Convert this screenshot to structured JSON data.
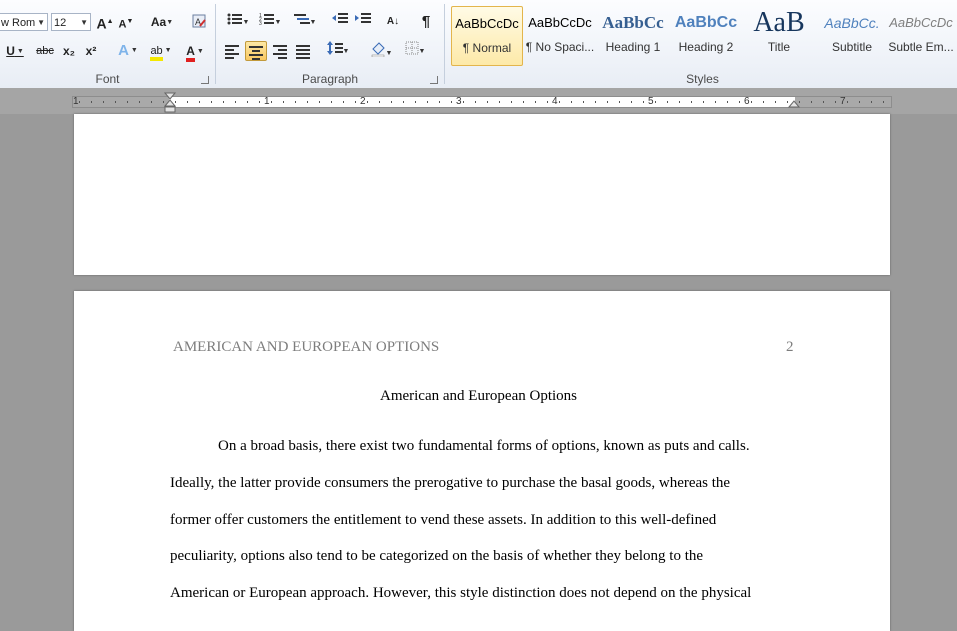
{
  "font_group": {
    "font_name": "w Rom",
    "font_size": "12",
    "label": "Font",
    "grow_label": "A",
    "shrink_label": "A",
    "case_label": "Aa",
    "underline_label": "U",
    "strike_label": "abc",
    "subscript_label": "x₂",
    "superscript_label": "x²",
    "effects_label": "A",
    "highlight_label": "ab",
    "font_color_label": "A"
  },
  "paragraph_group": {
    "label": "Paragraph",
    "pilcrow": "¶",
    "sort_label": "A↓"
  },
  "styles_group": {
    "label": "Styles",
    "styles": [
      {
        "sample": "AaBbCcDc",
        "name": "¶ Normal",
        "selected": true
      },
      {
        "sample": "AaBbCcDc",
        "name": "¶ No Spaci..."
      },
      {
        "sample": "AaBbCc",
        "name": "Heading 1"
      },
      {
        "sample": "AaBbCc",
        "name": "Heading 2"
      },
      {
        "sample": "AaB",
        "name": "Title"
      },
      {
        "sample": "AaBbCc.",
        "name": "Subtitle"
      },
      {
        "sample": "AaBbCcDc",
        "name": "Subtle Em..."
      }
    ]
  },
  "ruler": {
    "numbers": [
      "1",
      "1",
      "2",
      "3",
      "4",
      "5",
      "6",
      "7"
    ]
  },
  "document": {
    "running_head": "AMERICAN AND EUROPEAN OPTIONS",
    "page_number": "2",
    "title": "American and European Options",
    "lines": [
      "On a broad basis, there exist two fundamental forms of options, known as puts and calls.",
      "Ideally, the latter provide consumers the prerogative to purchase the basal goods, whereas the",
      "former offer customers the entitlement to vend these assets. In addition to this well-defined",
      "peculiarity, options also tend to be categorized on the basis of whether they belong to the",
      "American or European approach. However, this style distinction does not depend on the physical"
    ]
  }
}
